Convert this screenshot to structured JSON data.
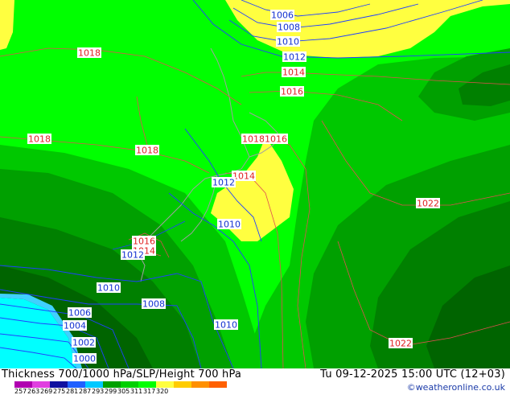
{
  "footer": {
    "title": "Thickness 700/1000 hPa/SLP/Height 700 hPa",
    "valid_time": "Tu 09-12-2025 15:00 UTC (12+03)",
    "credit": "©weatheronline.co.uk",
    "scale_labels": [
      "257",
      "263",
      "269",
      "275",
      "281",
      "287",
      "293",
      "299",
      "305",
      "311",
      "317",
      "320"
    ],
    "scale_colors": [
      "#b000b0",
      "#e040e0",
      "#1010a0",
      "#2060ff",
      "#00c8ff",
      "#00a000",
      "#00d000",
      "#00ff00",
      "#ffff40",
      "#ffcc00",
      "#ff9000",
      "#ff6000"
    ]
  },
  "isobars": {
    "red": [
      "1018",
      "1018",
      "1018",
      "1018",
      "1016",
      "1014",
      "1016",
      "1014",
      "1016",
      "1014",
      "1022",
      "1022"
    ],
    "blue": [
      "1006",
      "1008",
      "1010",
      "1012",
      "1012",
      "1010",
      "1012",
      "1010",
      "1008",
      "1006",
      "1004",
      "1002",
      "1000",
      "1010"
    ]
  },
  "colors": {
    "land_dark": "#006400",
    "land_mid": "#00a000",
    "land_light": "#00c800",
    "land_bright": "#00ff00",
    "yellow": "#ffff40",
    "cyan": "#00ffff",
    "isobar_red": "#ff3030",
    "isobar_blue": "#2040ff",
    "coast": "#a0a0a0"
  }
}
